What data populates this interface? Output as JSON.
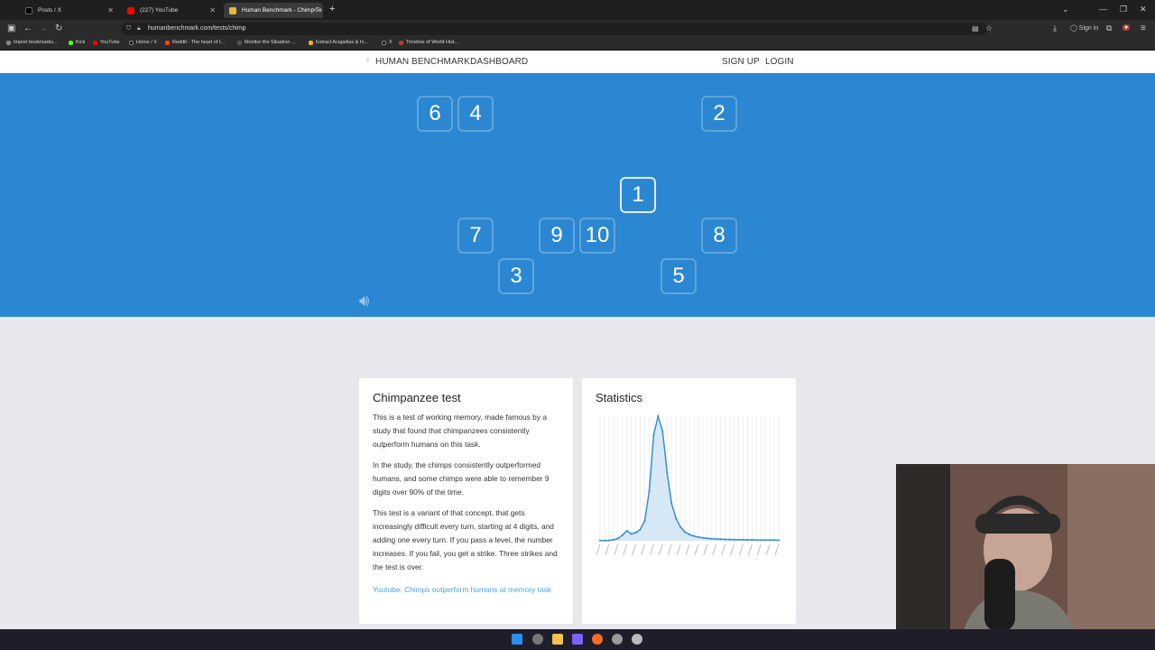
{
  "browser": {
    "tabs": [
      {
        "title": "Posts / X",
        "color": "#000000"
      },
      {
        "title": "(227) YouTube",
        "color": "#ff0000"
      },
      {
        "title": "Human Benchmark - Chimp Te",
        "color": "#e9b63b"
      }
    ],
    "url": "humanbenchmark.com/tests/chimp",
    "sign_in": "Sign in",
    "bookmarks": [
      "Import bookmarks...",
      "Kick",
      "YouTube",
      "Home / X",
      "Reddit - The heart of t...",
      "Monitor the Situation ...",
      "Extract Acapellas & In...",
      "X",
      "Timeline of World Hist..."
    ]
  },
  "site_nav": {
    "brand": "HUMAN BENCHMARK",
    "dashboard": "DASHBOARD",
    "signup": "SIGN UP",
    "login": "LOGIN"
  },
  "test": {
    "background": "#2b87d1",
    "cells": [
      {
        "label": "6"
      },
      {
        "label": "4"
      },
      {
        "label": "2"
      },
      {
        "label": "1"
      },
      {
        "label": "7"
      },
      {
        "label": "9"
      },
      {
        "label": "10"
      },
      {
        "label": "8"
      },
      {
        "label": "3"
      },
      {
        "label": "5"
      }
    ]
  },
  "info_card": {
    "title": "Chimpanzee test",
    "paragraphs": [
      "This is a test of working memory, made famous by a study that found that chimpanzees consistently outperform humans on this task.",
      "In the study, the chimps consistently outperformed humans, and some chimps were able to remember 9 digits over 90% of the time.",
      "This test is a variant of that concept, that gets increasingly difficult every turn, starting at 4 digits, and adding one every turn. If you pass a level, the number increases. If you fail, you get a strike. Three strikes and the test is over."
    ],
    "link": "Youtube: Chimps outperform humans at memory task"
  },
  "stats_card": {
    "title": "Statistics"
  },
  "chart_data": {
    "type": "area",
    "x": [
      0,
      1,
      2,
      3,
      4,
      5,
      6,
      7,
      8,
      9,
      10,
      11,
      12,
      13,
      14,
      15,
      16,
      17,
      18,
      19,
      20,
      21,
      22,
      23,
      24,
      25,
      26,
      27,
      28,
      29,
      30,
      31,
      32,
      33,
      34,
      35,
      36,
      37,
      38,
      39,
      40
    ],
    "values": [
      0.2,
      0.2,
      0.3,
      0.8,
      1.8,
      4.5,
      8.0,
      5.5,
      6.5,
      9.0,
      16,
      40,
      85,
      100,
      88,
      55,
      30,
      18,
      11,
      7,
      5,
      3.8,
      3,
      2.4,
      2,
      1.6,
      1.4,
      1.2,
      1.1,
      1,
      0.9,
      0.8,
      0.8,
      0.7,
      0.7,
      0.6,
      0.6,
      0.5,
      0.5,
      0.5,
      0.4
    ],
    "grid": true,
    "color": "#3a8fd0"
  }
}
